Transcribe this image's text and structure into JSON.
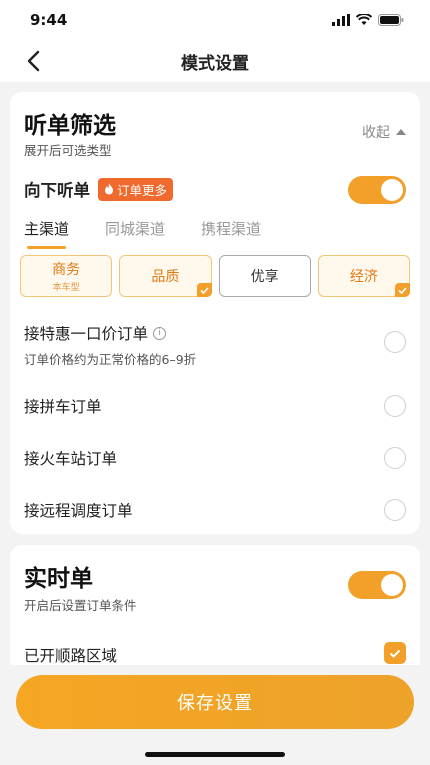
{
  "status_bar": {
    "time": "9:44"
  },
  "nav": {
    "title": "模式设置"
  },
  "listen_filter": {
    "title": "听单筛选",
    "subtitle": "展开后可选类型",
    "collapse_label": "收起",
    "down_listen": {
      "label": "向下听单",
      "badge": "订单更多",
      "enabled": true
    },
    "tabs": [
      {
        "label": "主渠道",
        "active": true
      },
      {
        "label": "同城渠道",
        "active": false
      },
      {
        "label": "携程渠道",
        "active": false
      }
    ],
    "chips": [
      {
        "label": "商务",
        "sub": "本车型",
        "selected": true,
        "checked": false
      },
      {
        "label": "品质",
        "sub": "",
        "selected": true,
        "checked": true
      },
      {
        "label": "优享",
        "sub": "",
        "selected": false,
        "checked": false
      },
      {
        "label": "经济",
        "sub": "",
        "selected": true,
        "checked": true
      }
    ],
    "options": [
      {
        "label": "接特惠一口价订单",
        "desc": "订单价格约为正常价格的6–9折",
        "checked": false
      },
      {
        "label": "接拼车订单",
        "checked": false
      },
      {
        "label": "接火车站订单",
        "checked": false
      },
      {
        "label": "接远程调度订单",
        "checked": false
      }
    ]
  },
  "realtime": {
    "title": "实时单",
    "subtitle": "开启后设置订单条件",
    "enabled": true,
    "route_area": {
      "label": "已开顺路区域",
      "checked": true
    }
  },
  "save_button": {
    "label": "保存设置"
  },
  "colors": {
    "accent": "#f2a02a",
    "badge": "#f06a2d"
  }
}
